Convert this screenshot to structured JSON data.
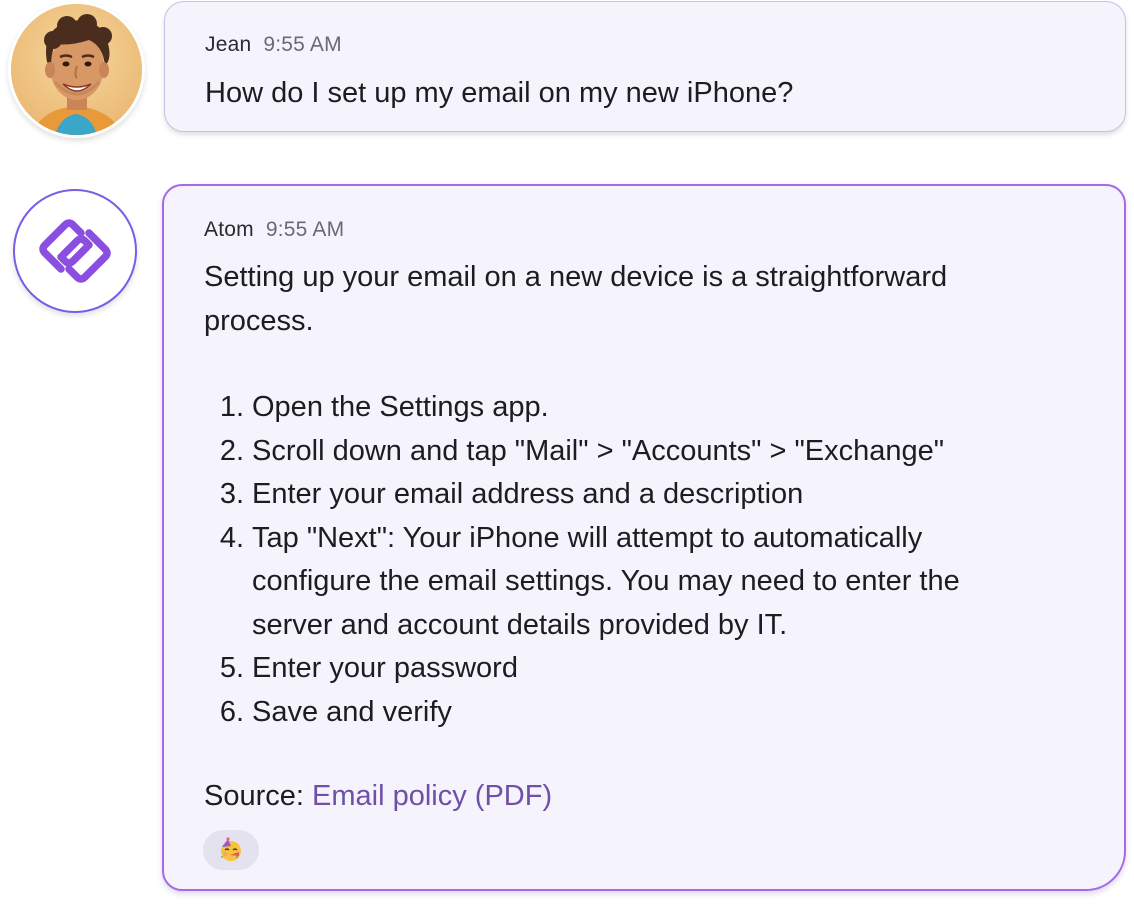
{
  "messages": [
    {
      "sender": "Jean",
      "time": "9:55 AM",
      "text": "How do I set up my email on my new iPhone?"
    },
    {
      "sender": "Atom",
      "time": "9:55 AM",
      "intro_line1": "Setting up your email on a new device is a straightforward",
      "intro_line2": "process.",
      "steps": [
        {
          "num": "1.",
          "lines": [
            "Open the Settings app."
          ]
        },
        {
          "num": "2.",
          "lines": [
            "Scroll down and tap \"Mail\" > \"Accounts\" > \"Exchange\""
          ]
        },
        {
          "num": "3.",
          "lines": [
            "Enter your email address and a description"
          ]
        },
        {
          "num": "4.",
          "lines": [
            "Tap \"Next\": Your iPhone will attempt to automatically",
            "configure the email settings. You may need to enter the",
            "server and account details provided by IT."
          ]
        },
        {
          "num": "5.",
          "lines": [
            "Enter your password"
          ]
        },
        {
          "num": "6.",
          "lines": [
            "Save and verify"
          ]
        }
      ],
      "source_label": "Source:",
      "source_link": "Email policy (PDF)",
      "reaction": "partying-face-emoji"
    }
  ],
  "colors": {
    "bubble_bg": "#f5f4fd",
    "atom_border": "#a46ae8",
    "link": "#6f4fa8",
    "logo": "#8a4ee0"
  }
}
